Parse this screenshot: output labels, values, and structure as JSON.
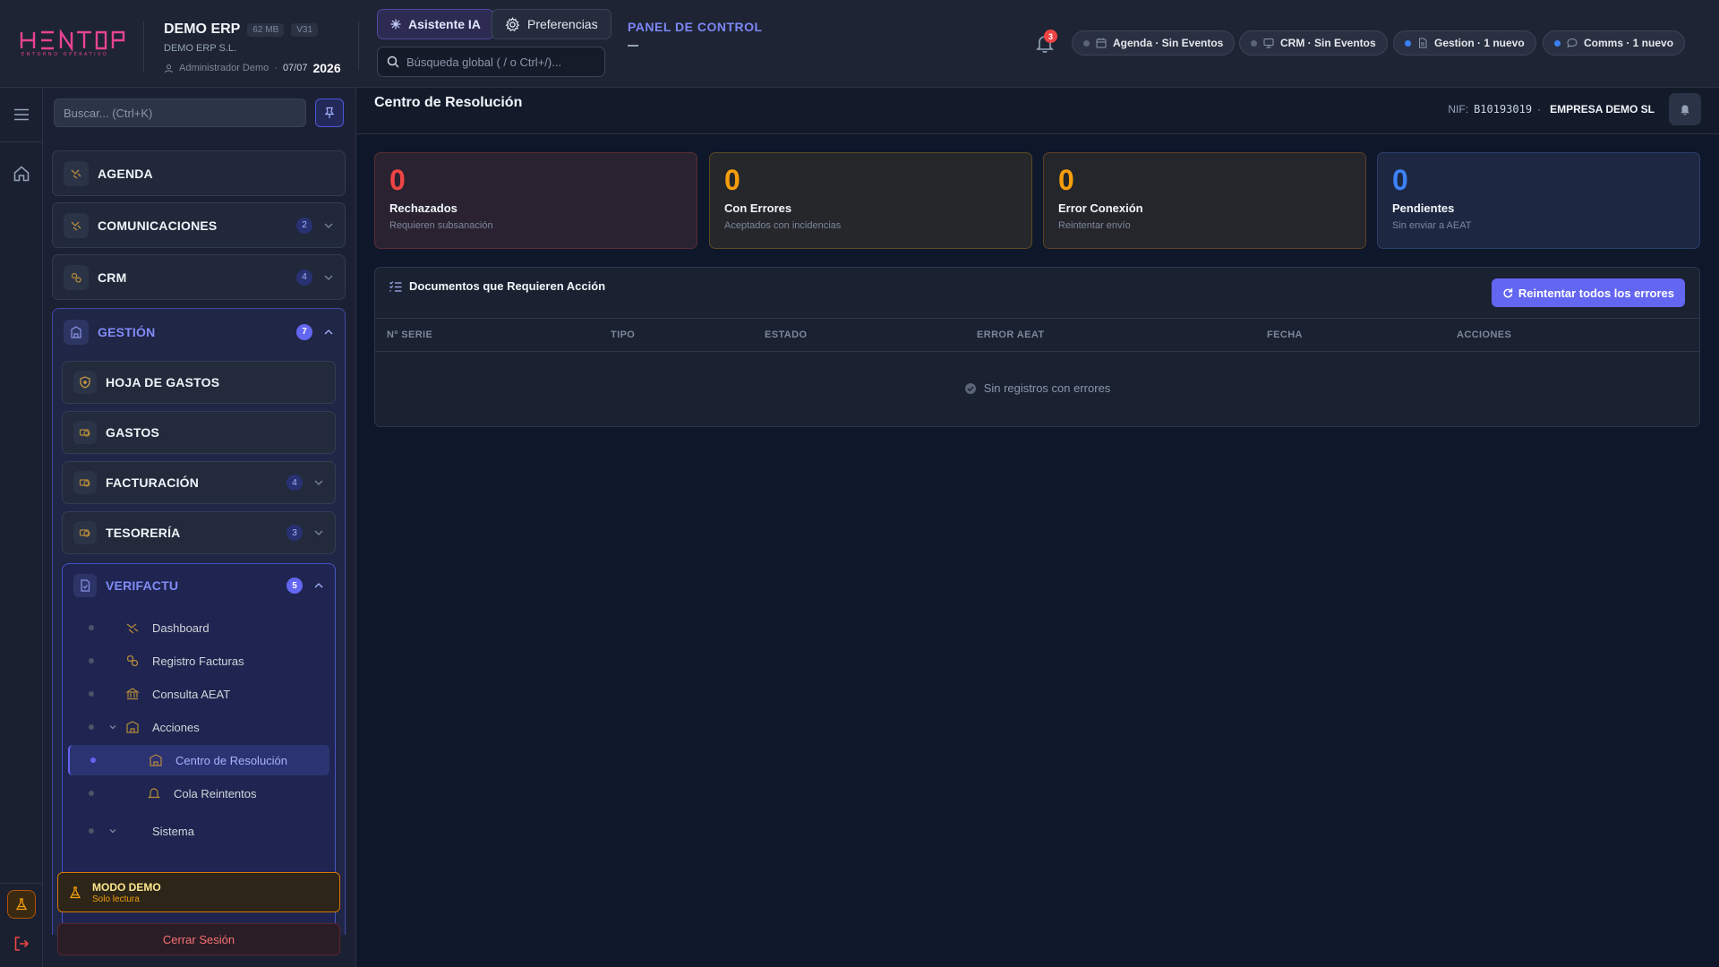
{
  "topbar": {
    "company_name": "DEMO ERP",
    "size_badge": "62 MB",
    "version_badge": "V31",
    "company_legal": "DEMO ERP S.L.",
    "user": "Administrador Demo",
    "date": "07/07",
    "year": "2026",
    "ai_button": "Asistente IA",
    "prefs_button": "Preferencias",
    "search_placeholder": "Búsqueda global ( / o Ctrl+/)...",
    "panel_link": "PANEL DE CONTROL",
    "notifications_count": "3",
    "pills": [
      {
        "label": "Agenda · Sin Eventos",
        "icon": "calendar-icon",
        "dot": "gray"
      },
      {
        "label": "CRM · Sin Eventos",
        "icon": "monitor-icon",
        "dot": "gray"
      },
      {
        "label": "Gestion · 1 nuevo",
        "icon": "document-icon",
        "dot": "blue"
      },
      {
        "label": "Comms · 1 nuevo",
        "icon": "chat-icon",
        "dot": "blue"
      }
    ]
  },
  "sidebar": {
    "search_placeholder": "Buscar... (Ctrl+K)",
    "items": [
      {
        "label": "AGENDA"
      },
      {
        "label": "COMUNICACIONES",
        "count": "2"
      },
      {
        "label": "CRM",
        "count": "4"
      },
      {
        "label": "GESTIÓN",
        "count": "7"
      }
    ],
    "gestion_items": [
      {
        "label": "HOJA DE GASTOS"
      },
      {
        "label": "GASTOS"
      },
      {
        "label": "FACTURACIÓN",
        "count": "4"
      },
      {
        "label": "TESORERÍA",
        "count": "3"
      },
      {
        "label": "VERIFACTU",
        "count": "5"
      }
    ],
    "verifactu_items": [
      {
        "label": "Dashboard"
      },
      {
        "label": "Registro Facturas"
      },
      {
        "label": "Consulta AEAT"
      },
      {
        "label": "Acciones"
      },
      {
        "label": "Centro de Resolución"
      },
      {
        "label": "Cola Reintentos"
      },
      {
        "label": "Sistema"
      }
    ],
    "demo_title": "MODO DEMO",
    "demo_sub": "Solo lectura",
    "logout": "Cerrar Sesión"
  },
  "main": {
    "title": "Centro de Resolución",
    "nif_label": "NIF:",
    "nif_value": "B10193019",
    "company": "EMPRESA DEMO SL",
    "stats": [
      {
        "value": "0",
        "label": "Rechazados",
        "hint": "Requieren subsanación"
      },
      {
        "value": "0",
        "label": "Con Errores",
        "hint": "Aceptados con incidencias"
      },
      {
        "value": "0",
        "label": "Error Conexión",
        "hint": "Reintentar envío"
      },
      {
        "value": "0",
        "label": "Pendientes",
        "hint": "Sin enviar a AEAT"
      }
    ],
    "table": {
      "title": "Documentos que Requieren Acción",
      "retry_button": "Reintentar todos los errores",
      "columns": [
        "Nº SERIE",
        "TIPO",
        "ESTADO",
        "ERROR AEAT",
        "FECHA",
        "ACCIONES"
      ],
      "empty": "Sin registros con errores"
    }
  },
  "colors": {
    "accent": "#6366f1",
    "danger": "#ef4444",
    "warning": "#f59e0b",
    "info": "#3b82f6",
    "logo": "#e84393"
  }
}
